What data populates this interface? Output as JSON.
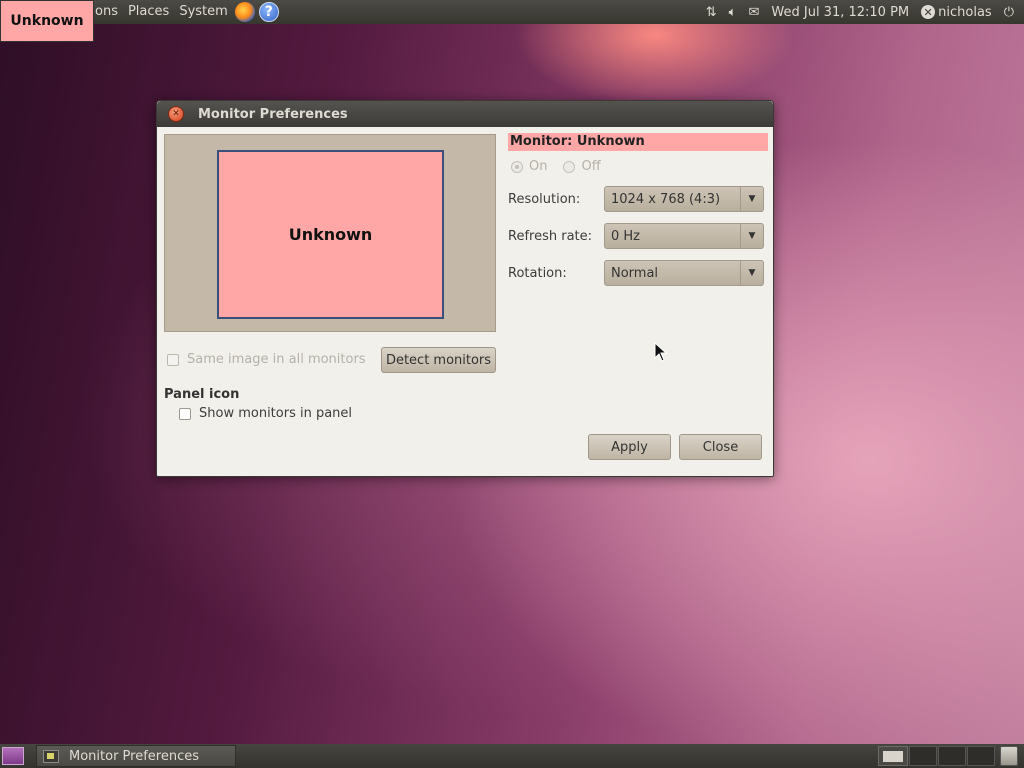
{
  "top_panel": {
    "menus": [
      "ons",
      "Places",
      "System"
    ],
    "clock": "Wed Jul 31, 12:10 PM",
    "user": "nicholas"
  },
  "corner_badge": "Unknown",
  "dialog": {
    "title": "Monitor Preferences",
    "preview_monitor_label": "Unknown",
    "monitor_header": "Monitor: Unknown",
    "power": {
      "on_label": "On",
      "off_label": "Off",
      "selected": "On"
    },
    "resolution": {
      "label": "Resolution:",
      "value": "1024 x 768 (4:3)"
    },
    "refresh_rate": {
      "label": "Refresh rate:",
      "value": "0 Hz"
    },
    "rotation": {
      "label": "Rotation:",
      "value": "Normal"
    },
    "same_image_label": "Same image in all monitors",
    "detect_button": "Detect monitors",
    "panel_icon_title": "Panel icon",
    "show_monitors_label": "Show monitors in panel",
    "apply_button": "Apply",
    "close_button": "Close"
  },
  "bottom_panel": {
    "task_label": "Monitor Preferences"
  },
  "icons": [
    "firefox-icon",
    "help-icon",
    "network-icon",
    "volume-icon",
    "mail-icon",
    "user-status-icon",
    "power-icon",
    "show-desktop-icon",
    "trash-icon"
  ]
}
